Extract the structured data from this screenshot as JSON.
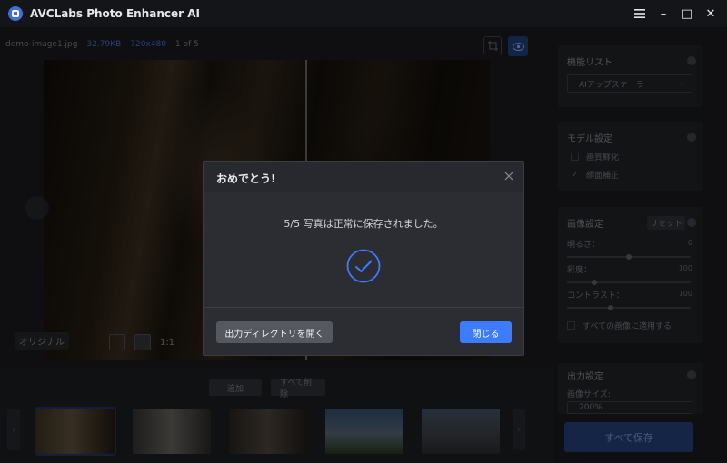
{
  "window": {
    "title": "AVCLabs Photo Enhancer AI",
    "menu_icon": "hamburger-icon",
    "minimize_glyph": "–",
    "maximize_glyph": "□",
    "close_glyph": "✕"
  },
  "file_info": {
    "name": "demo-image1.jpg",
    "size": "32.79KB",
    "resolution": "720x480",
    "position": "1 of 5"
  },
  "viewer": {
    "original_label": "オリジナル",
    "zoom_label": "1:1"
  },
  "thumbnails": {
    "add_label": "追加",
    "delete_all_label": "すべて削除",
    "items": [
      "demo-image1",
      "demo-image2",
      "demo-image3",
      "demo-image4",
      "demo-image5"
    ],
    "prev_glyph": "‹",
    "next_glyph": "›"
  },
  "right_panel": {
    "feature_list": {
      "title": "機能リスト",
      "selected": "AIアップスケーラー"
    },
    "model_settings": {
      "title": "モデル設定",
      "options": [
        {
          "label": "画質鮮化",
          "checked": false
        },
        {
          "label": "顔面補正",
          "checked": true
        }
      ]
    },
    "image_settings": {
      "title": "画像設定",
      "reset_label": "リセット",
      "sliders": [
        {
          "label": "明るさ：",
          "value": "0",
          "level": 0.5
        },
        {
          "label": "彩度：",
          "value": "100",
          "level": 0.22
        },
        {
          "label": "コントラスト：",
          "value": "100",
          "level": 0.35
        }
      ],
      "apply_all_label": "すべての画像に適用する"
    },
    "output_settings": {
      "title": "出力設定",
      "image_size_label": "画像サイズ:",
      "image_size_value": "200%"
    },
    "save_all_label": "すべて保存"
  },
  "dialog": {
    "title": "おめでとう!",
    "message": "5/5 写真は正常に保存されました。",
    "open_dir_label": "出力ディレクトリを開く",
    "close_label": "閉じる",
    "accent_color": "#3d7bff"
  }
}
